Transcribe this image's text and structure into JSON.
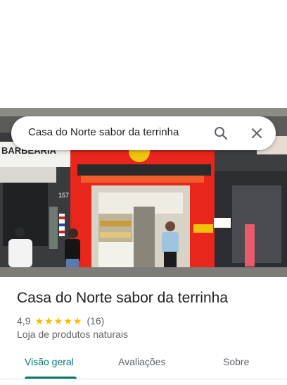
{
  "search": {
    "query": "Casa do Norte sabor da terrinha",
    "search_icon": "search-icon",
    "close_icon": "close-icon"
  },
  "photo": {
    "sign_left": "BARBEARIA",
    "house_number": "157"
  },
  "place": {
    "name": "Casa do Norte sabor da terrinha",
    "rating": "4,9",
    "rating_value": 4.9,
    "review_count": "(16)",
    "category": "Loja de produtos naturais"
  },
  "tabs": [
    {
      "label": "Visão geral",
      "active": true
    },
    {
      "label": "Avaliações",
      "active": false
    },
    {
      "label": "Sobre",
      "active": false
    }
  ],
  "colors": {
    "accent": "#00796b",
    "star": "#fbbc04",
    "storefront_red": "#e8261c"
  }
}
